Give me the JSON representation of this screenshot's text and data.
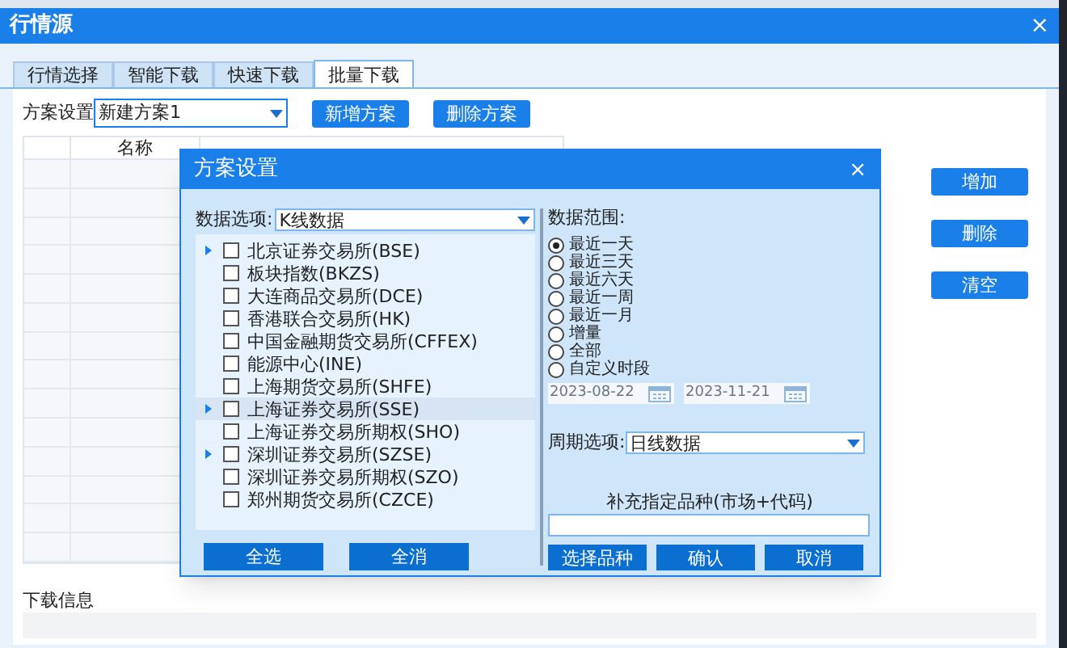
{
  "window": {
    "title": "行情源",
    "close": "×"
  },
  "tabs": [
    {
      "label": "行情选择",
      "selected": false
    },
    {
      "label": "智能下载",
      "selected": false
    },
    {
      "label": "快速下载",
      "selected": false
    },
    {
      "label": "批量下载",
      "selected": true
    }
  ],
  "scheme": {
    "label": "方案设置",
    "value": "新建方案1",
    "buttons": [
      "新增方案",
      "删除方案"
    ]
  },
  "table": {
    "columns": [
      "名称"
    ]
  },
  "side_buttons": [
    "增加",
    "删除",
    "清空"
  ],
  "download_info": {
    "label": "下载信息"
  },
  "dialog": {
    "title": "方案设置",
    "close": "×",
    "data_option": {
      "label": "数据选项:",
      "value": "K线数据"
    },
    "markets": [
      {
        "label": "北京证券交易所(BSE)",
        "expandable": true,
        "checked": false,
        "selected": false
      },
      {
        "label": "板块指数(BKZS)",
        "expandable": false,
        "checked": false,
        "selected": false
      },
      {
        "label": "大连商品交易所(DCE)",
        "expandable": false,
        "checked": false,
        "selected": false
      },
      {
        "label": "香港联合交易所(HK)",
        "expandable": false,
        "checked": false,
        "selected": false
      },
      {
        "label": "中国金融期货交易所(CFFEX)",
        "expandable": false,
        "checked": false,
        "selected": false
      },
      {
        "label": "能源中心(INE)",
        "expandable": false,
        "checked": false,
        "selected": false
      },
      {
        "label": "上海期货交易所(SHFE)",
        "expandable": false,
        "checked": false,
        "selected": false
      },
      {
        "label": "上海证券交易所(SSE)",
        "expandable": true,
        "checked": false,
        "selected": true
      },
      {
        "label": "上海证券交易所期权(SHO)",
        "expandable": false,
        "checked": false,
        "selected": false
      },
      {
        "label": "深圳证券交易所(SZSE)",
        "expandable": true,
        "checked": false,
        "selected": false
      },
      {
        "label": "深圳证券交易所期权(SZO)",
        "expandable": false,
        "checked": false,
        "selected": false
      },
      {
        "label": "郑州期货交易所(CZCE)",
        "expandable": false,
        "checked": false,
        "selected": false
      }
    ],
    "list_buttons": [
      "全选",
      "全消"
    ],
    "range": {
      "label": "数据范围:",
      "options": [
        {
          "label": "最近一天",
          "selected": true
        },
        {
          "label": "最近三天",
          "selected": false
        },
        {
          "label": "最近六天",
          "selected": false
        },
        {
          "label": "最近一周",
          "selected": false
        },
        {
          "label": "最近一月",
          "selected": false
        },
        {
          "label": "增量",
          "selected": false
        },
        {
          "label": "全部",
          "selected": false
        },
        {
          "label": "自定义时段",
          "selected": false
        }
      ],
      "start_date": "2023-08-22",
      "end_date": "2023-11-21",
      "dates_disabled": true
    },
    "period": {
      "label": "周期选项:",
      "value": "日线数据"
    },
    "extra": {
      "label": "补充指定品种(市场+代码)"
    },
    "buttons": [
      "选择品种",
      "确认",
      "取消"
    ]
  }
}
